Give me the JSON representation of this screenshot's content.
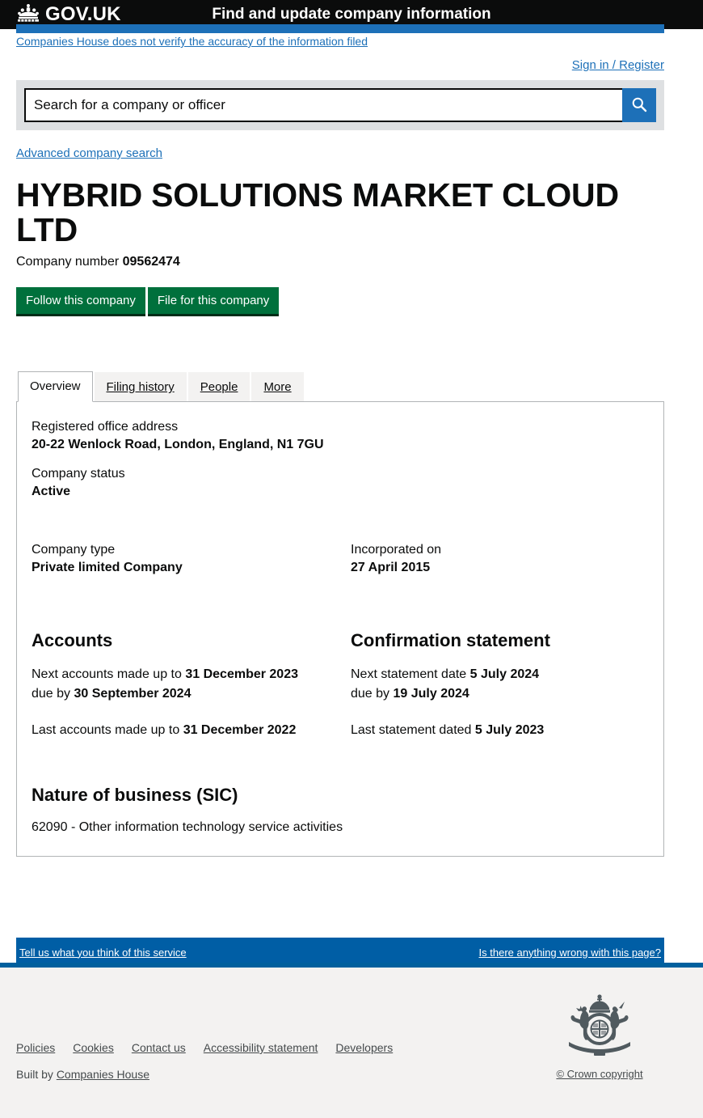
{
  "header": {
    "brand": "GOV.UK",
    "crown_icon": "crown-icon",
    "service_name": "Find and update company information"
  },
  "notice": {
    "text": "Companies House does not verify the accuracy of the information filed"
  },
  "account": {
    "sign_in_label": "Sign in / Register"
  },
  "search": {
    "placeholder": "Search for a company or officer",
    "value": "",
    "button_icon": "search-icon",
    "advanced_link": "Advanced company search"
  },
  "company": {
    "name": "HYBRID SOLUTIONS MARKET CLOUD LTD",
    "number_label": "Company number",
    "number": "09562474",
    "follow_button": "Follow this company",
    "file_button": "File for this company"
  },
  "tabs": [
    {
      "label": "Overview",
      "active": true
    },
    {
      "label": "Filing history",
      "active": false
    },
    {
      "label": "People",
      "active": false
    },
    {
      "label": "More",
      "active": false
    }
  ],
  "overview": {
    "registered_office_label": "Registered office address",
    "registered_office_value": "20-22 Wenlock Road, London, England, N1 7GU",
    "company_status_label": "Company status",
    "company_status_value": "Active",
    "company_type_label": "Company type",
    "company_type_value": "Private limited Company",
    "incorporated_label": "Incorporated on",
    "incorporated_value": "27 April 2015"
  },
  "accounts": {
    "heading": "Accounts",
    "next_prefix": "Next accounts made up to",
    "next_date": "31 December 2023",
    "due_prefix": "due by",
    "due_date": "30 September 2024",
    "last_prefix": "Last accounts made up to",
    "last_date": "31 December 2022"
  },
  "confirmation_statement": {
    "heading": "Confirmation statement",
    "next_prefix": "Next statement date",
    "next_date": "5 July 2024",
    "due_prefix": "due by",
    "due_date": "19 July 2024",
    "last_prefix": "Last statement dated",
    "last_date": "5 July 2023"
  },
  "sic": {
    "heading": "Nature of business (SIC)",
    "code_description": "62090 - Other information technology service activities"
  },
  "feedback": {
    "left_link": "Tell us what you think of this service",
    "right_link": "Is there anything wrong with this page?"
  },
  "footer": {
    "links": [
      "Policies",
      "Cookies",
      "Contact us",
      "Accessibility statement",
      "Developers"
    ],
    "built_by_prefix": "Built by",
    "built_by_link": "Companies House",
    "crest_icon": "royal-coat-of-arms-icon",
    "crown_copyright": "© Crown copyright"
  },
  "colors": {
    "govuk_black": "#0b0c0c",
    "govuk_blue": "#1d70b8",
    "feedback_blue": "#005ea5",
    "green_button": "#00703c",
    "footer_grey": "#f3f2f1",
    "search_shell_grey": "#dee0e2"
  }
}
